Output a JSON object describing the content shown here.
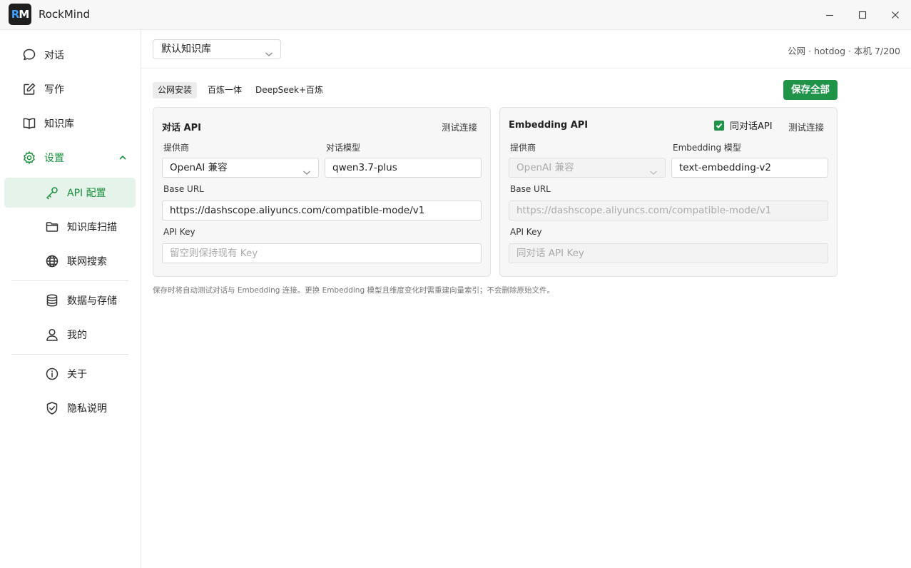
{
  "app": {
    "logo_r": "R",
    "logo_m": "M",
    "title": "RockMind"
  },
  "sidebar": {
    "chat": "对话",
    "write": "写作",
    "knowledge": "知识库",
    "settings": "设置",
    "api_config": "API 配置",
    "kb_scan": "知识库扫描",
    "web_search": "联网搜索",
    "data_storage": "数据与存储",
    "me": "我的",
    "about": "关于",
    "privacy": "隐私说明"
  },
  "header": {
    "kb_select": "默认知识库",
    "status": "公网 · hotdog · 本机 7/200"
  },
  "tabs": [
    "公网安装",
    "百炼一体",
    "DeepSeek+百炼"
  ],
  "save_all": "保存全部",
  "chat_api": {
    "title": "对话 API",
    "test": "测试连接",
    "provider_label": "提供商",
    "provider_value": "OpenAI 兼容",
    "model_label": "对话模型",
    "model_value": "qwen3.7-plus",
    "base_url_label": "Base URL",
    "base_url_value": "https://dashscope.aliyuncs.com/compatible-mode/v1",
    "api_key_label": "API Key",
    "api_key_placeholder": "留空则保持现有 Key"
  },
  "embedding_api": {
    "title": "Embedding API",
    "same_as_chat": "同对话API",
    "same_as_chat_checked": true,
    "test": "测试连接",
    "provider_label": "提供商",
    "provider_value": "OpenAI 兼容",
    "model_label": "Embedding 模型",
    "model_value": "text-embedding-v2",
    "base_url_label": "Base URL",
    "base_url_value": "https://dashscope.aliyuncs.com/compatible-mode/v1",
    "api_key_label": "API Key",
    "api_key_placeholder": "同对话 API Key"
  },
  "note": "保存时将自动测试对话与 Embedding 连接。更换 Embedding 模型且维度变化时需重建向量索引；不会删除原始文件。",
  "colors": {
    "accent": "#1f9448",
    "accent_text": "#1a8f3c",
    "active_bg": "#e6f3ea"
  }
}
